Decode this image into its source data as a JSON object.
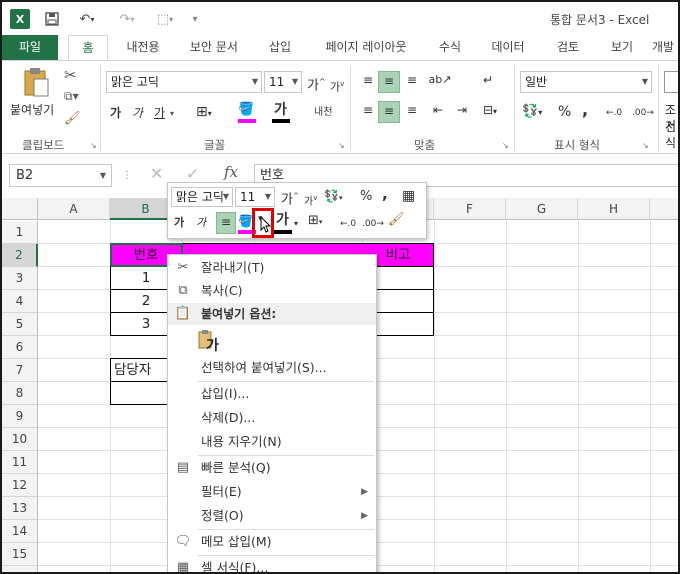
{
  "titlebar": {
    "title": "통합 문서3 - Excel",
    "app_icon": "excel-icon",
    "save_icon": "save-icon",
    "undo_icon": "undo-icon",
    "redo_icon": "redo-icon"
  },
  "tabs": [
    {
      "label": "파일"
    },
    {
      "label": "홈"
    },
    {
      "label": "내전용"
    },
    {
      "label": "보안 문서"
    },
    {
      "label": "삽입"
    },
    {
      "label": "페이지 레이아웃"
    },
    {
      "label": "수식"
    },
    {
      "label": "데이터"
    },
    {
      "label": "검토"
    },
    {
      "label": "보기"
    },
    {
      "label": "개발"
    }
  ],
  "ribbon": {
    "clipboard": {
      "paste_label": "붙여넣기",
      "group_label": "클립보드"
    },
    "font": {
      "font_name": "맑은 고딕",
      "font_size": "11",
      "group_label": "글꼴",
      "bold": "가",
      "italic": "가",
      "underline": "가",
      "font_color": "가",
      "wrap_text": "내천"
    },
    "align": {
      "group_label": "맞춤"
    },
    "number": {
      "format": "일반",
      "group_label": "표시 형식",
      "percent": "%",
      "comma": ","
    },
    "styles": {
      "partial_label_1": "조건",
      "partial_label_2": "서식"
    }
  },
  "formula_bar": {
    "name_box": "B2",
    "fx": "fx",
    "value": "번호"
  },
  "sheet": {
    "columns": [
      "A",
      "B",
      "C",
      "D",
      "E",
      "F",
      "G",
      "H"
    ],
    "rows": [
      "1",
      "2",
      "3",
      "4",
      "5",
      "6",
      "7",
      "8",
      "9",
      "10",
      "11",
      "12",
      "13",
      "14",
      "15",
      "16"
    ],
    "cells": {
      "B2": "번호",
      "E2": "비고",
      "B3": "1",
      "B4": "2",
      "B5": "3",
      "B7": "담당자"
    },
    "header_fill": "#ff00ff"
  },
  "mini_toolbar": {
    "font_name": "맑은 고딕",
    "font_size": "11",
    "bold": "가",
    "italic": "가",
    "percent": "%",
    "comma": ",",
    "font_color": "가"
  },
  "context_menu": {
    "items": [
      {
        "label": "잘라내기(T)",
        "icon": "cut-icon"
      },
      {
        "label": "복사(C)",
        "icon": "copy-icon"
      },
      {
        "label": "붙여넣기 옵션:",
        "icon": "paste-icon"
      },
      {
        "label": "가",
        "icon": "paste-values-icon"
      },
      {
        "label": "선택하여 붙여넣기(S)...",
        "icon": ""
      },
      {
        "label": "삽입(I)...",
        "icon": ""
      },
      {
        "label": "삭제(D)...",
        "icon": ""
      },
      {
        "label": "내용 지우기(N)",
        "icon": ""
      },
      {
        "label": "빠른 분석(Q)",
        "icon": "quick-analysis-icon"
      },
      {
        "label": "필터(E)",
        "icon": ""
      },
      {
        "label": "정렬(O)",
        "icon": ""
      },
      {
        "label": "메모 삽입(M)",
        "icon": "comment-icon"
      },
      {
        "label": "셀 서식(F)...",
        "icon": "format-cells-icon"
      }
    ]
  }
}
